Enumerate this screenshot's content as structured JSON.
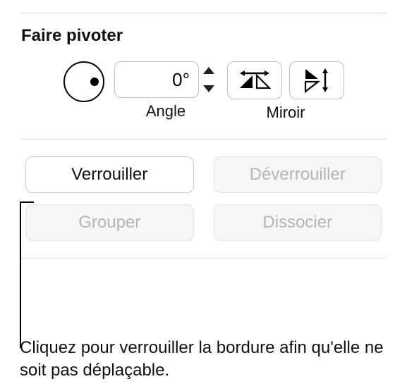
{
  "section": {
    "title": "Faire pivoter"
  },
  "rotate": {
    "angle_value": "0°",
    "angle_label": "Angle",
    "mirror_label": "Miroir"
  },
  "buttons": {
    "lock": "Verrouiller",
    "unlock": "Déverrouiller",
    "group": "Grouper",
    "ungroup": "Dissocier"
  },
  "caption": "Cliquez pour verrouiller la bordure afin qu'elle ne soit pas déplaçable."
}
